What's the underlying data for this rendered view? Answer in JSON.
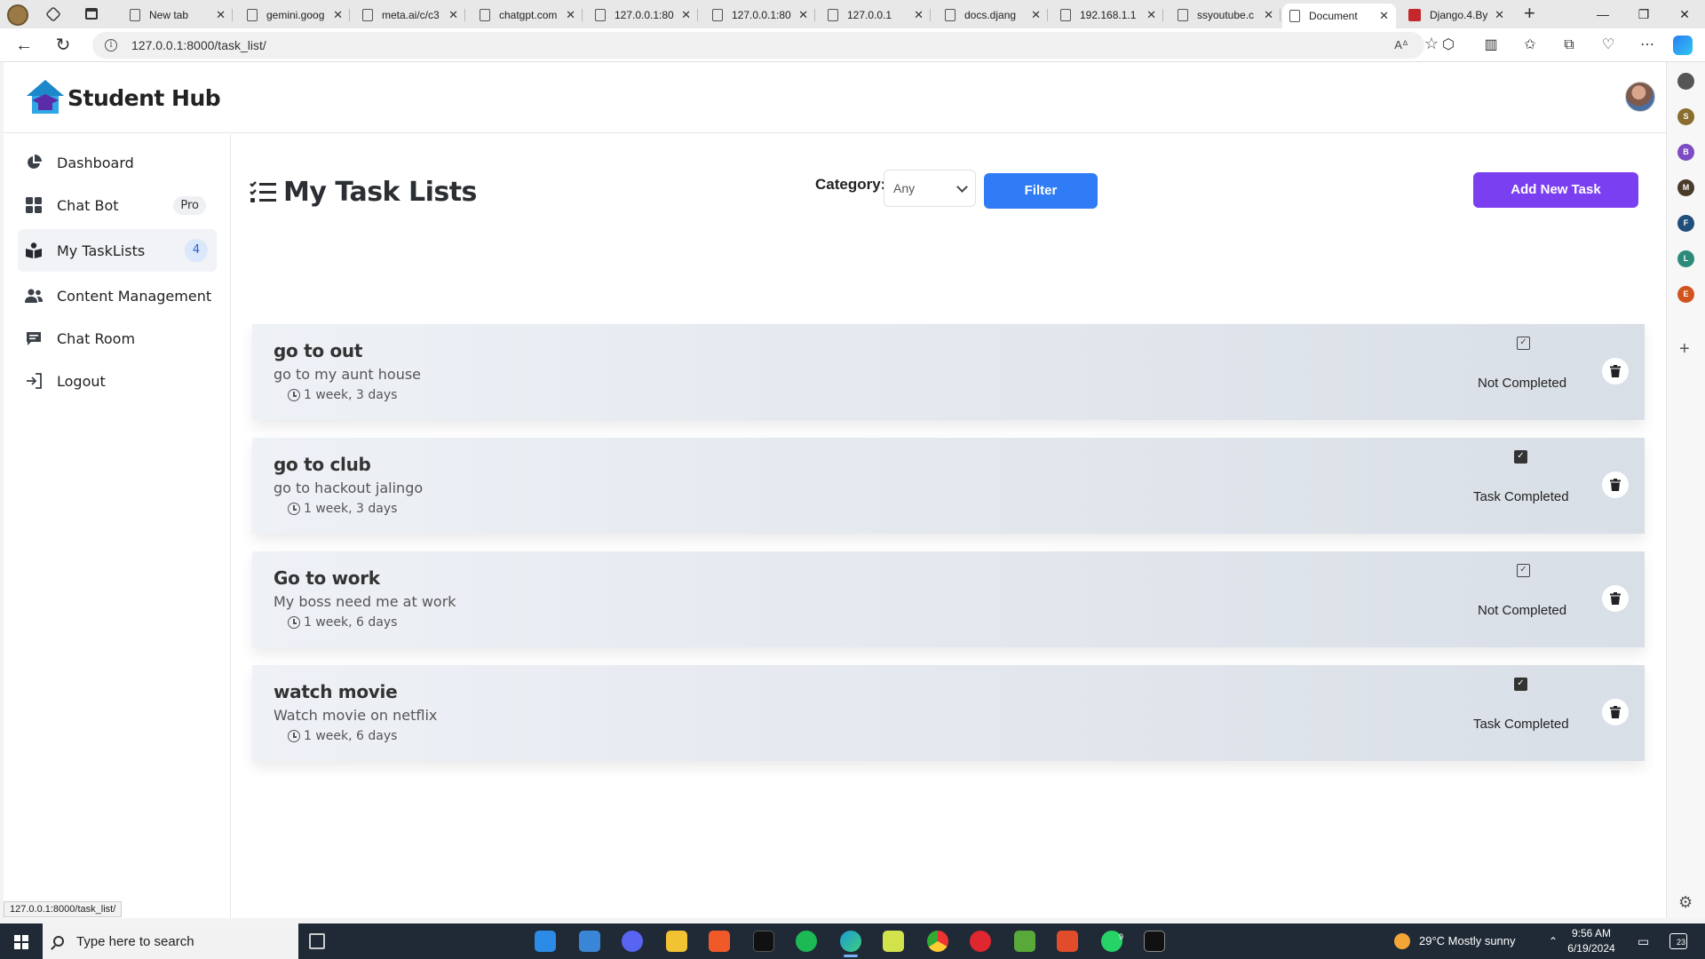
{
  "browser": {
    "tabs": [
      {
        "label": "New tab",
        "active": false
      },
      {
        "label": "gemini.goog",
        "active": false
      },
      {
        "label": "meta.ai/c/c3",
        "active": false
      },
      {
        "label": "chatgpt.com",
        "active": false
      },
      {
        "label": "127.0.0.1:80",
        "active": false
      },
      {
        "label": "127.0.0.1:80",
        "active": false
      },
      {
        "label": "127.0.0.1",
        "active": false
      },
      {
        "label": "docs.djang",
        "active": false
      },
      {
        "label": "192.168.1.1",
        "active": false
      },
      {
        "label": "ssyoutube.c",
        "active": false
      },
      {
        "label": "Document",
        "active": true
      },
      {
        "label": "Django.4.By",
        "active": false
      }
    ],
    "url": "127.0.0.1:8000/task_list/",
    "status_url": "127.0.0.1:8000/task_list/",
    "side_rail_letters": [
      "S",
      "B",
      "M",
      "F",
      "L",
      "E"
    ]
  },
  "header": {
    "brand": "Student Hub"
  },
  "sidebar": {
    "items": [
      {
        "label": "Dashboard",
        "icon": "pie-chart-icon",
        "active": false
      },
      {
        "label": "Chat Bot",
        "icon": "grid-icon",
        "badge": "Pro",
        "active": false
      },
      {
        "label": "My TaskLists",
        "icon": "book-reader-icon",
        "count": "4",
        "active": true
      },
      {
        "label": "Content Management",
        "icon": "users-icon",
        "active": false
      },
      {
        "label": "Chat Room",
        "icon": "chat-icon",
        "active": false
      },
      {
        "label": "Logout",
        "icon": "logout-icon",
        "active": false
      }
    ]
  },
  "main": {
    "title": "My Task Lists",
    "category_label": "Category:",
    "category_value": "Any",
    "filter_label": "Filter",
    "add_label": "Add New Task",
    "tasks": [
      {
        "title": "go to out",
        "description": "go to my aunt house",
        "age": "1 week, 3 days",
        "status": "Not Completed",
        "completed": false
      },
      {
        "title": "go to club",
        "description": "go to hackout jalingo",
        "age": "1 week, 3 days",
        "status": "Task Completed",
        "completed": true
      },
      {
        "title": "Go to work",
        "description": "My boss need me at work",
        "age": "1 week, 6 days",
        "status": "Not Completed",
        "completed": false
      },
      {
        "title": "watch movie",
        "description": "Watch movie on netflix",
        "age": "1 week, 6 days",
        "status": "Task Completed",
        "completed": true
      }
    ]
  },
  "taskbar": {
    "search_placeholder": "Type here to search",
    "weather": "29°C  Mostly sunny",
    "time": "9:56 AM",
    "date": "6/19/2024",
    "notifications": "23",
    "whatsapp_badge": "9"
  },
  "colors": {
    "filter_button": "#2f7cf6",
    "add_button": "#7b3ff2",
    "active_nav_bg": "#f1f3f6",
    "count_badge_bg": "#dbe7fb"
  }
}
